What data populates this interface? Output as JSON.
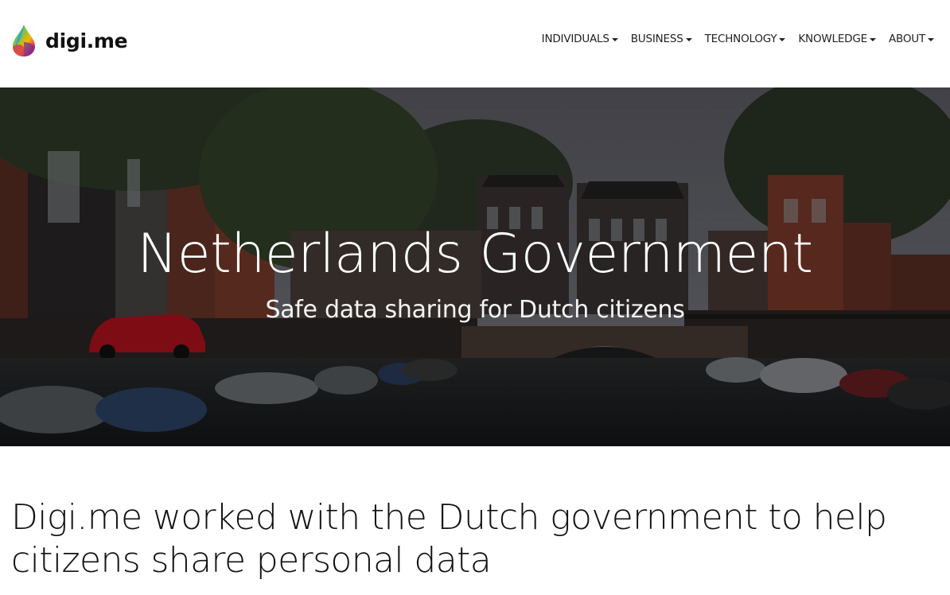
{
  "brand": {
    "name": "digi.me"
  },
  "nav": {
    "items": [
      {
        "label": "INDIVIDUALS"
      },
      {
        "label": "BUSINESS"
      },
      {
        "label": "TECHNOLOGY"
      },
      {
        "label": "KNOWLEDGE"
      },
      {
        "label": "ABOUT"
      }
    ]
  },
  "hero": {
    "title": "Netherlands Government",
    "subtitle": "Safe data sharing for Dutch citizens",
    "image": "amsterdam-canal-photo"
  },
  "main": {
    "heading": "Digi.me worked with the Dutch government to help citizens share personal data"
  },
  "colors": {
    "text": "#111111",
    "hero_overlay": "#000000"
  }
}
